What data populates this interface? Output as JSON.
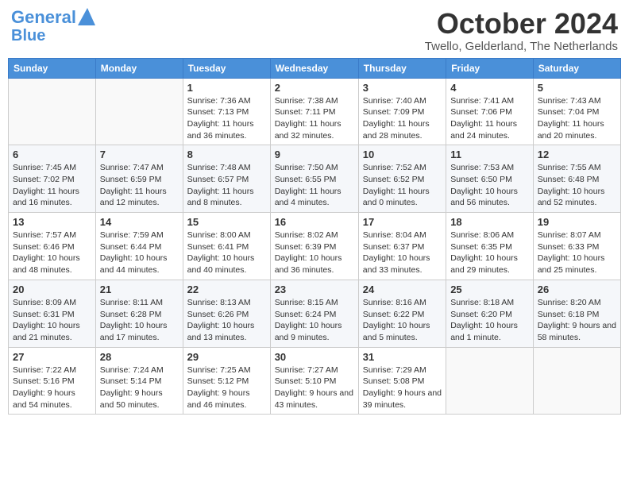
{
  "header": {
    "logo_general": "General",
    "logo_blue": "Blue",
    "month": "October 2024",
    "location": "Twello, Gelderland, The Netherlands"
  },
  "weekdays": [
    "Sunday",
    "Monday",
    "Tuesday",
    "Wednesday",
    "Thursday",
    "Friday",
    "Saturday"
  ],
  "weeks": [
    [
      {
        "day": "",
        "sunrise": "",
        "sunset": "",
        "daylight": ""
      },
      {
        "day": "",
        "sunrise": "",
        "sunset": "",
        "daylight": ""
      },
      {
        "day": "1",
        "sunrise": "Sunrise: 7:36 AM",
        "sunset": "Sunset: 7:13 PM",
        "daylight": "Daylight: 11 hours and 36 minutes."
      },
      {
        "day": "2",
        "sunrise": "Sunrise: 7:38 AM",
        "sunset": "Sunset: 7:11 PM",
        "daylight": "Daylight: 11 hours and 32 minutes."
      },
      {
        "day": "3",
        "sunrise": "Sunrise: 7:40 AM",
        "sunset": "Sunset: 7:09 PM",
        "daylight": "Daylight: 11 hours and 28 minutes."
      },
      {
        "day": "4",
        "sunrise": "Sunrise: 7:41 AM",
        "sunset": "Sunset: 7:06 PM",
        "daylight": "Daylight: 11 hours and 24 minutes."
      },
      {
        "day": "5",
        "sunrise": "Sunrise: 7:43 AM",
        "sunset": "Sunset: 7:04 PM",
        "daylight": "Daylight: 11 hours and 20 minutes."
      }
    ],
    [
      {
        "day": "6",
        "sunrise": "Sunrise: 7:45 AM",
        "sunset": "Sunset: 7:02 PM",
        "daylight": "Daylight: 11 hours and 16 minutes."
      },
      {
        "day": "7",
        "sunrise": "Sunrise: 7:47 AM",
        "sunset": "Sunset: 6:59 PM",
        "daylight": "Daylight: 11 hours and 12 minutes."
      },
      {
        "day": "8",
        "sunrise": "Sunrise: 7:48 AM",
        "sunset": "Sunset: 6:57 PM",
        "daylight": "Daylight: 11 hours and 8 minutes."
      },
      {
        "day": "9",
        "sunrise": "Sunrise: 7:50 AM",
        "sunset": "Sunset: 6:55 PM",
        "daylight": "Daylight: 11 hours and 4 minutes."
      },
      {
        "day": "10",
        "sunrise": "Sunrise: 7:52 AM",
        "sunset": "Sunset: 6:52 PM",
        "daylight": "Daylight: 11 hours and 0 minutes."
      },
      {
        "day": "11",
        "sunrise": "Sunrise: 7:53 AM",
        "sunset": "Sunset: 6:50 PM",
        "daylight": "Daylight: 10 hours and 56 minutes."
      },
      {
        "day": "12",
        "sunrise": "Sunrise: 7:55 AM",
        "sunset": "Sunset: 6:48 PM",
        "daylight": "Daylight: 10 hours and 52 minutes."
      }
    ],
    [
      {
        "day": "13",
        "sunrise": "Sunrise: 7:57 AM",
        "sunset": "Sunset: 6:46 PM",
        "daylight": "Daylight: 10 hours and 48 minutes."
      },
      {
        "day": "14",
        "sunrise": "Sunrise: 7:59 AM",
        "sunset": "Sunset: 6:44 PM",
        "daylight": "Daylight: 10 hours and 44 minutes."
      },
      {
        "day": "15",
        "sunrise": "Sunrise: 8:00 AM",
        "sunset": "Sunset: 6:41 PM",
        "daylight": "Daylight: 10 hours and 40 minutes."
      },
      {
        "day": "16",
        "sunrise": "Sunrise: 8:02 AM",
        "sunset": "Sunset: 6:39 PM",
        "daylight": "Daylight: 10 hours and 36 minutes."
      },
      {
        "day": "17",
        "sunrise": "Sunrise: 8:04 AM",
        "sunset": "Sunset: 6:37 PM",
        "daylight": "Daylight: 10 hours and 33 minutes."
      },
      {
        "day": "18",
        "sunrise": "Sunrise: 8:06 AM",
        "sunset": "Sunset: 6:35 PM",
        "daylight": "Daylight: 10 hours and 29 minutes."
      },
      {
        "day": "19",
        "sunrise": "Sunrise: 8:07 AM",
        "sunset": "Sunset: 6:33 PM",
        "daylight": "Daylight: 10 hours and 25 minutes."
      }
    ],
    [
      {
        "day": "20",
        "sunrise": "Sunrise: 8:09 AM",
        "sunset": "Sunset: 6:31 PM",
        "daylight": "Daylight: 10 hours and 21 minutes."
      },
      {
        "day": "21",
        "sunrise": "Sunrise: 8:11 AM",
        "sunset": "Sunset: 6:28 PM",
        "daylight": "Daylight: 10 hours and 17 minutes."
      },
      {
        "day": "22",
        "sunrise": "Sunrise: 8:13 AM",
        "sunset": "Sunset: 6:26 PM",
        "daylight": "Daylight: 10 hours and 13 minutes."
      },
      {
        "day": "23",
        "sunrise": "Sunrise: 8:15 AM",
        "sunset": "Sunset: 6:24 PM",
        "daylight": "Daylight: 10 hours and 9 minutes."
      },
      {
        "day": "24",
        "sunrise": "Sunrise: 8:16 AM",
        "sunset": "Sunset: 6:22 PM",
        "daylight": "Daylight: 10 hours and 5 minutes."
      },
      {
        "day": "25",
        "sunrise": "Sunrise: 8:18 AM",
        "sunset": "Sunset: 6:20 PM",
        "daylight": "Daylight: 10 hours and 1 minute."
      },
      {
        "day": "26",
        "sunrise": "Sunrise: 8:20 AM",
        "sunset": "Sunset: 6:18 PM",
        "daylight": "Daylight: 9 hours and 58 minutes."
      }
    ],
    [
      {
        "day": "27",
        "sunrise": "Sunrise: 7:22 AM",
        "sunset": "Sunset: 5:16 PM",
        "daylight": "Daylight: 9 hours and 54 minutes."
      },
      {
        "day": "28",
        "sunrise": "Sunrise: 7:24 AM",
        "sunset": "Sunset: 5:14 PM",
        "daylight": "Daylight: 9 hours and 50 minutes."
      },
      {
        "day": "29",
        "sunrise": "Sunrise: 7:25 AM",
        "sunset": "Sunset: 5:12 PM",
        "daylight": "Daylight: 9 hours and 46 minutes."
      },
      {
        "day": "30",
        "sunrise": "Sunrise: 7:27 AM",
        "sunset": "Sunset: 5:10 PM",
        "daylight": "Daylight: 9 hours and 43 minutes."
      },
      {
        "day": "31",
        "sunrise": "Sunrise: 7:29 AM",
        "sunset": "Sunset: 5:08 PM",
        "daylight": "Daylight: 9 hours and 39 minutes."
      },
      {
        "day": "",
        "sunrise": "",
        "sunset": "",
        "daylight": ""
      },
      {
        "day": "",
        "sunrise": "",
        "sunset": "",
        "daylight": ""
      }
    ]
  ]
}
